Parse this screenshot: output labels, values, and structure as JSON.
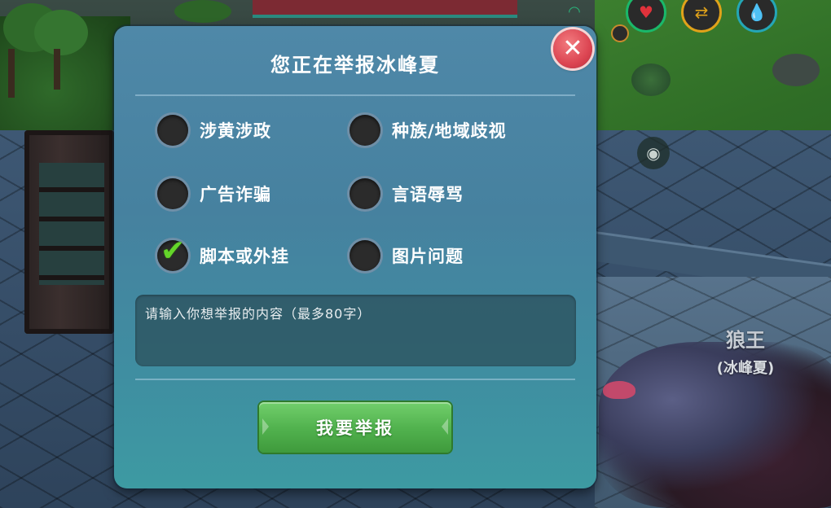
{
  "dialog": {
    "title": "您正在举报冰峰夏",
    "close_icon": "close-icon",
    "options": [
      {
        "label": "涉黄涉政",
        "checked": false
      },
      {
        "label": "种族/地域歧视",
        "checked": false
      },
      {
        "label": "广告诈骗",
        "checked": false
      },
      {
        "label": "言语辱骂",
        "checked": false
      },
      {
        "label": "脚本或外挂",
        "checked": true
      },
      {
        "label": "图片问题",
        "checked": false
      }
    ],
    "input": {
      "placeholder": "请输入你想举报的内容（最多80字）",
      "value": ""
    },
    "submit_label": "我要举报",
    "accent_color": "#52b34f",
    "close_color": "#dc4552"
  },
  "scene": {
    "npc_name": "狼王",
    "npc_subtitle": "(冰峰夏)",
    "hud_icons": [
      "signal-icon",
      "heart-icon",
      "swap-icon",
      "water-drop-icon",
      "eye-icon"
    ]
  }
}
